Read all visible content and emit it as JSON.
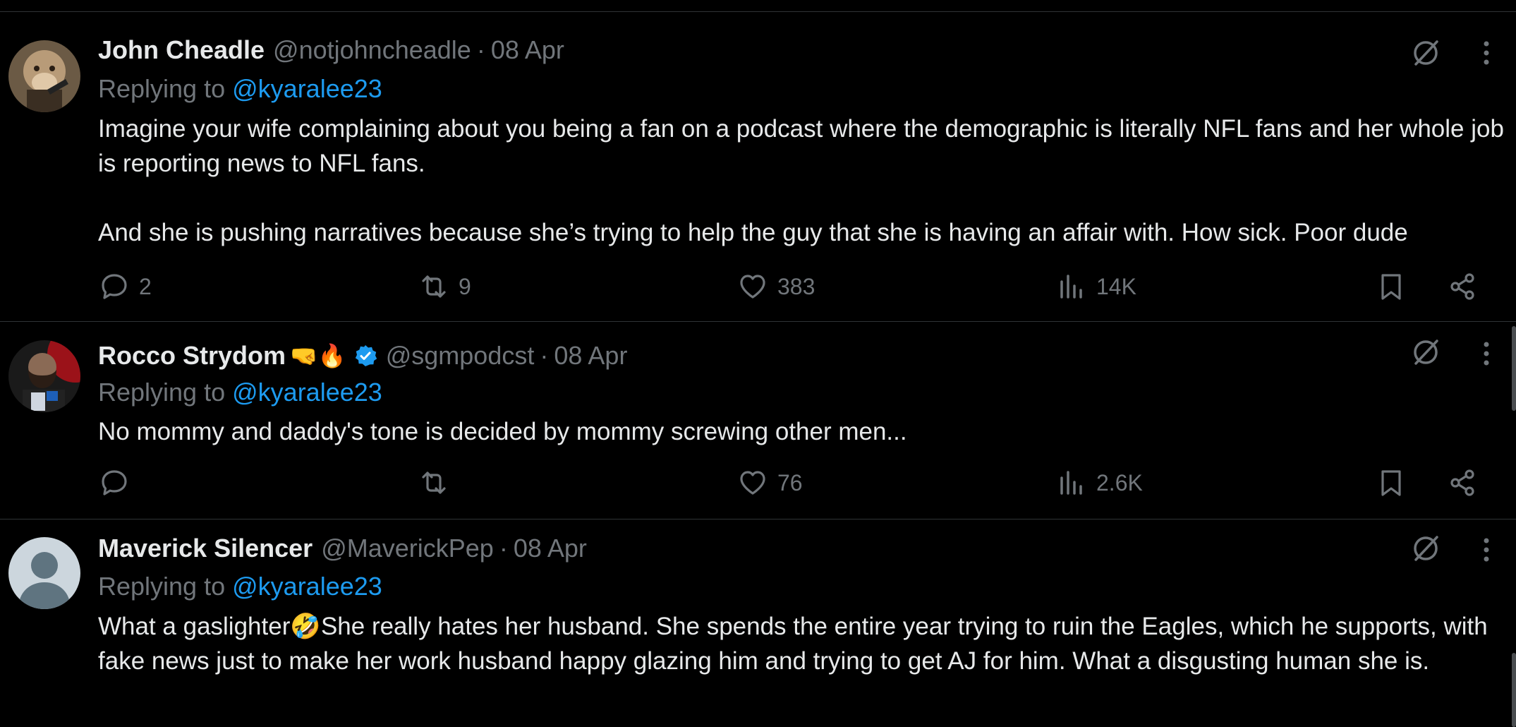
{
  "colors": {
    "background": "#000000",
    "text_primary": "#e7e9ea",
    "text_secondary": "#71767b",
    "link": "#1d9bf0",
    "divider": "#2f3336"
  },
  "tweets": [
    {
      "display_name": "John Cheadle",
      "handle": "@notjohncheadle",
      "separator": "·",
      "date": "08 Apr",
      "replying_prefix": "Replying to",
      "replying_to": "@kyaralee23",
      "body_p1": "Imagine your wife complaining about you being a fan on a podcast where the demographic is literally NFL fans and her whole job is reporting news to NFL fans.",
      "body_p2": "And she is pushing narratives because she’s trying to help the guy that she is having an affair with. How sick. Poor dude",
      "replies": "2",
      "reposts": "9",
      "likes": "383",
      "views": "14K",
      "avatar_icon": "monkey-avatar"
    },
    {
      "display_name": "Rocco Strydom",
      "emojis": "🤜🔥",
      "verified": true,
      "handle": "@sgmpodcst",
      "separator": "·",
      "date": "08 Apr",
      "replying_prefix": "Replying to",
      "replying_to": "@kyaralee23",
      "body_p1": "No mommy and daddy's tone is decided by mommy screwing other men...",
      "replies": "",
      "reposts": "",
      "likes": "76",
      "views": "2.6K",
      "avatar_icon": "bearded-man-avatar"
    },
    {
      "display_name": "Maverick Silencer",
      "handle": "@MaverickPep",
      "separator": "·",
      "date": "08 Apr",
      "replying_prefix": "Replying to",
      "replying_to": "@kyaralee23",
      "body_p1": "What a gaslighter🤣She really hates her husband. She spends the entire year trying to ruin the Eagles, which he supports, with fake news just to make her work husband happy glazing him and trying to get AJ for him. What a disgusting human she is.",
      "avatar_icon": "default-profile-avatar"
    }
  ]
}
